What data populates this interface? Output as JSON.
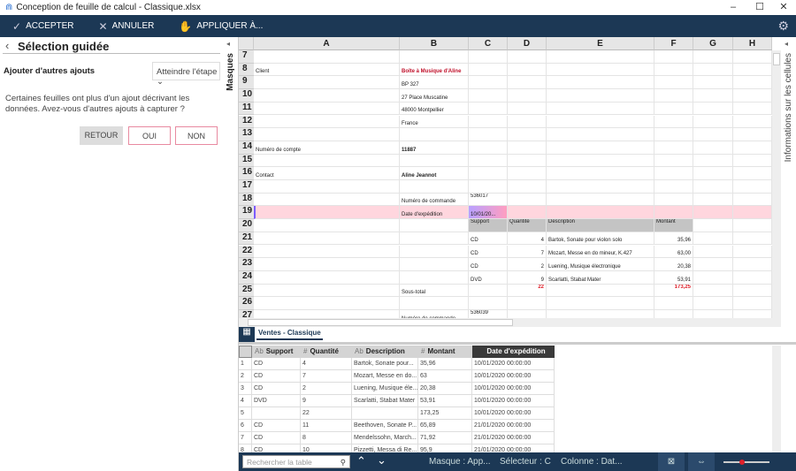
{
  "window": {
    "title": "Conception de feuille de calcul - Classique.xlsx"
  },
  "toolbar": {
    "accept": "ACCEPTER",
    "cancel": "ANNULER",
    "apply": "APPLIQUER À..."
  },
  "left": {
    "title": "Sélection guidée",
    "label": "Ajouter d'autres ajouts",
    "select": "Atteindre l'étape",
    "message": "Certaines feuilles ont plus d'un ajout décrivant les données. Avez-vous d'autres ajouts à capturer ?",
    "back": "RETOUR",
    "yes": "OUI",
    "no": "NON",
    "masks": "Masques"
  },
  "right": {
    "label": "Informations sur les cellules"
  },
  "grid": {
    "columns": [
      "A",
      "B",
      "C",
      "D",
      "E",
      "F",
      "G",
      "H"
    ],
    "rows": [
      {
        "n": "7",
        "cells": {}
      },
      {
        "n": "8",
        "cells": {
          "A": "Client",
          "B": "Boîte à Musique d'Aline"
        }
      },
      {
        "n": "9",
        "cells": {
          "B": "BP 327"
        }
      },
      {
        "n": "10",
        "cells": {
          "B": "27 Place Muscatine"
        }
      },
      {
        "n": "11",
        "cells": {
          "B": "48000 Montpellier"
        }
      },
      {
        "n": "12",
        "cells": {
          "B": "France"
        }
      },
      {
        "n": "13",
        "cells": {}
      },
      {
        "n": "14",
        "cells": {
          "A": "Numéro de compte",
          "B": "11887"
        }
      },
      {
        "n": "15",
        "cells": {}
      },
      {
        "n": "16",
        "cells": {
          "A": "Contact",
          "B": "Aline Jeannot"
        }
      },
      {
        "n": "17",
        "cells": {}
      },
      {
        "n": "18",
        "cells": {
          "B": "Numéro de commande",
          "C": "536017"
        }
      },
      {
        "n": "19",
        "cells": {
          "B": "Date d'expédition",
          "C": "10/01/20..."
        }
      },
      {
        "n": "20",
        "cells": {
          "C": "Support",
          "D": "Quantité",
          "E": "Description",
          "F": "Montant"
        }
      },
      {
        "n": "21",
        "cells": {
          "C": "CD",
          "D": "4",
          "E": "Bartok, Sonate pour violon solo",
          "F": "35,96"
        }
      },
      {
        "n": "22",
        "cells": {
          "C": "CD",
          "D": "7",
          "E": "Mozart, Messe en do mineur, K.427",
          "F": "63,00"
        }
      },
      {
        "n": "23",
        "cells": {
          "C": "CD",
          "D": "2",
          "E": "Luening, Musique électronique",
          "F": "20,38"
        }
      },
      {
        "n": "24",
        "cells": {
          "C": "DVD",
          "D": "9",
          "E": "Scarlatti, Stabat Mater",
          "F": "53,91"
        }
      },
      {
        "n": "25",
        "cells": {
          "B": "Sous-total",
          "D": "22",
          "F": "173,25"
        }
      },
      {
        "n": "26",
        "cells": {}
      },
      {
        "n": "27",
        "cells": {
          "B": "Numéro de commande",
          "C": "536039"
        }
      }
    ]
  },
  "sheet_tab": "Ventes - Classique",
  "table": {
    "headers": [
      {
        "type": "Ab",
        "label": "Support"
      },
      {
        "type": "#",
        "label": "Quantité"
      },
      {
        "type": "Ab",
        "label": "Description"
      },
      {
        "type": "#",
        "label": "Montant"
      },
      {
        "type": "",
        "label": "Date d'expédition"
      }
    ],
    "rows": [
      [
        "1",
        "CD",
        "4",
        "Bartok, Sonate pour...",
        "35,96",
        "10/01/2020 00:00:00"
      ],
      [
        "2",
        "CD",
        "7",
        "Mozart, Messe en do...",
        "63",
        "10/01/2020 00:00:00"
      ],
      [
        "3",
        "CD",
        "2",
        "Luening, Musique éle...",
        "20,38",
        "10/01/2020 00:00:00"
      ],
      [
        "4",
        "DVD",
        "9",
        "Scarlatti, Stabat Mater",
        "53,91",
        "10/01/2020 00:00:00"
      ],
      [
        "5",
        "",
        "22",
        "",
        "173,25",
        "10/01/2020 00:00:00"
      ],
      [
        "6",
        "CD",
        "11",
        "Beethoven, Sonate P...",
        "65,89",
        "21/01/2020 00:00:00"
      ],
      [
        "7",
        "CD",
        "8",
        "Mendelssohn, March...",
        "71,92",
        "21/01/2020 00:00:00"
      ],
      [
        "8",
        "CD",
        "10",
        "Pizzetti, Messa di Re...",
        "95,9",
        "21/01/2020 00:00:00"
      ],
      [
        "9",
        "LP",
        "6",
        "Divers, Trombone mo...",
        "64,74",
        "21/01/2020 00:00:00"
      ]
    ]
  },
  "status": {
    "search_placeholder": "Rechercher la table",
    "mask": "Masque : App...",
    "selector": "Sélecteur : C",
    "column": "Colonne : Dat...",
    "zoom_fraction": 0.4
  },
  "colors": {
    "navy": "#1c3855",
    "highlight": "#ffd6de",
    "red": "#e0202a"
  }
}
